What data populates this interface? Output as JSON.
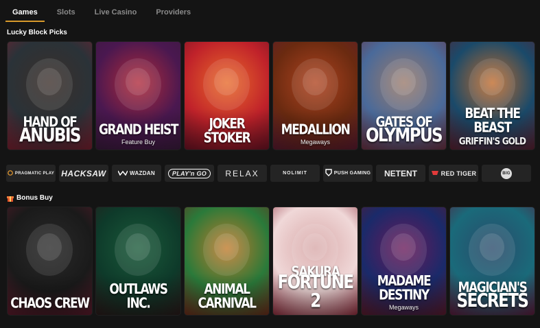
{
  "tabs": [
    "Games",
    "Slots",
    "Live Casino",
    "Providers"
  ],
  "sections": {
    "picks_title": "Lucky Block Picks",
    "bonus_title": "Bonus Buy"
  },
  "picks": [
    {
      "title": "HAND OF",
      "subtitle": "ANUBIS",
      "colors": [
        "#2a3238",
        "#3b2f2a",
        "#7a2030"
      ],
      "icon": "anubis-figure"
    },
    {
      "title": "GRAND HEIST",
      "subtitle": "Feature Buy",
      "colors": [
        "#4a1850",
        "#b02a3a",
        "#3a1a3c"
      ],
      "icon": "crown"
    },
    {
      "title": "JOKER STOKER",
      "subtitle": "",
      "colors": [
        "#c0222a",
        "#e86a2a",
        "#6a1224"
      ],
      "icon": "joker-face"
    },
    {
      "title": "MEDALLION",
      "subtitle": "Megaways",
      "colors": [
        "#6a2a10",
        "#b04420",
        "#5a1a30"
      ],
      "icon": "medallion"
    },
    {
      "title": "GATES OF",
      "subtitle": "OLYMPUS",
      "colors": [
        "#4a6a9a",
        "#9a7a6a",
        "#6a3040"
      ],
      "icon": "zeus"
    },
    {
      "title": "BEAT THE BEAST",
      "subtitle": "GRIFFIN'S GOLD",
      "colors": [
        "#1a4a6a",
        "#c06a2a",
        "#5a2030"
      ],
      "icon": "griffin"
    }
  ],
  "providers": [
    {
      "name": "PRAGMATIC PLAY",
      "icon": "pragmatic-play-logo"
    },
    {
      "name": "HACKSAW",
      "icon": "hacksaw-logo"
    },
    {
      "name": "WAZDAN",
      "icon": "wazdan-logo"
    },
    {
      "name": "PLAY'n GO",
      "icon": "playngo-logo"
    },
    {
      "name": "RELAX",
      "icon": "relax-gaming-logo"
    },
    {
      "name": "NOLIMIT",
      "icon": "nolimit-city-logo"
    },
    {
      "name": "PUSH GAMING",
      "icon": "push-gaming-logo"
    },
    {
      "name": "NETENT",
      "icon": "netent-logo"
    },
    {
      "name": "RED TIGER",
      "icon": "red-tiger-logo"
    },
    {
      "name": "BIG",
      "icon": "big-time-gaming-logo"
    }
  ],
  "bonus": [
    {
      "title": "CHAOS CREW",
      "subtitle": "",
      "colors": [
        "#1a1a1a",
        "#2a2a2a",
        "#5a1a2a"
      ],
      "icon": "chaos-skull"
    },
    {
      "title": "OUTLAWS INC.",
      "subtitle": "",
      "colors": [
        "#0e3a2a",
        "#1a5a3a",
        "#2a1a1a"
      ],
      "icon": "gorilla"
    },
    {
      "title": "ANIMAL CARNIVAL",
      "subtitle": "",
      "colors": [
        "#2a7a3a",
        "#c07a2a",
        "#6a2a1a"
      ],
      "icon": "tiger-king"
    },
    {
      "title": "SAKURA",
      "subtitle": "FORTUNE 2",
      "colors": [
        "#f0d8d8",
        "#d8a8a8",
        "#8a2a3a"
      ],
      "icon": "geisha"
    },
    {
      "title": "MADAME DESTINY",
      "subtitle": "Megaways",
      "colors": [
        "#1a2a6a",
        "#6a1a5a",
        "#5a1a2a"
      ],
      "icon": "fortune-teller"
    },
    {
      "title": "MAGICIAN'S",
      "subtitle": "SECRETS",
      "colors": [
        "#1a6a7a",
        "#2a4a6a",
        "#5a1a3a"
      ],
      "icon": "wizard"
    }
  ]
}
